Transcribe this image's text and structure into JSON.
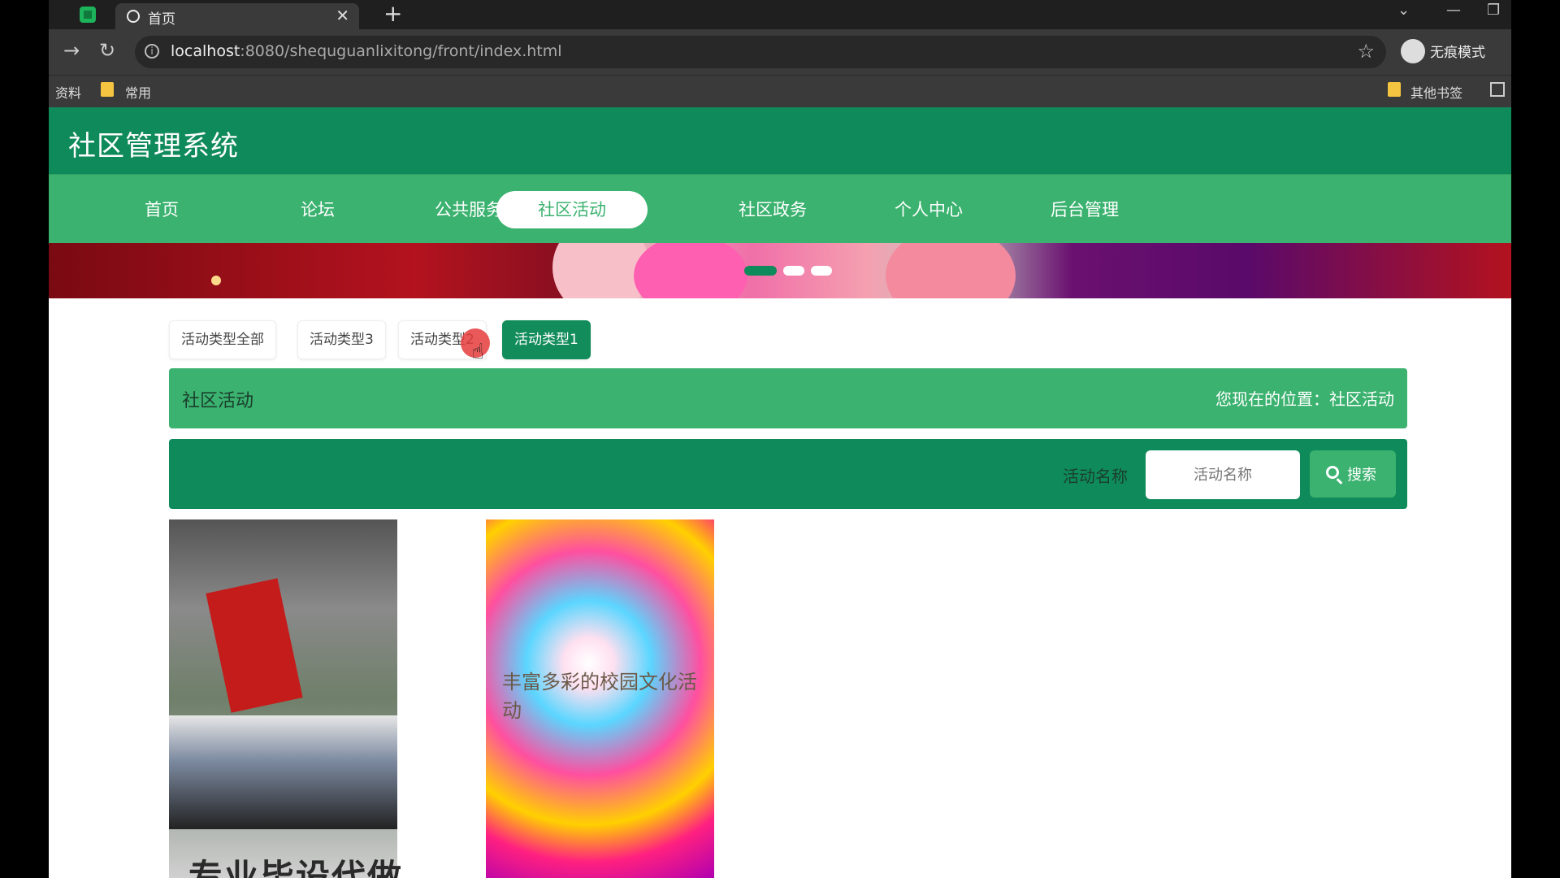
{
  "browser": {
    "tab_title": "首页",
    "tab_close": "✕",
    "new_tab": "+",
    "url_host": "localhost",
    "url_path": ":8080/shequguanlixitong/front/index.html",
    "incognito_label": "无痕模式",
    "bookmarks": [
      "资料",
      "常用"
    ],
    "other_bookmarks": "其他书签",
    "icons": {
      "back": "←",
      "forward": "→",
      "reload": "↻",
      "star": "☆",
      "minimize": "—",
      "restore": "❐",
      "dropdown": "⌄",
      "info": "i"
    }
  },
  "site": {
    "title": "社区管理系统",
    "nav": [
      {
        "label": "首页"
      },
      {
        "label": "论坛"
      },
      {
        "label": "公共服务"
      },
      {
        "label": "社区活动",
        "active": true
      },
      {
        "label": "社区政务"
      },
      {
        "label": "个人中心"
      },
      {
        "label": "后台管理"
      }
    ]
  },
  "filters": [
    {
      "label": "活动类型全部"
    },
    {
      "label": "活动类型3"
    },
    {
      "label": "活动类型2"
    },
    {
      "label": "活动类型1",
      "active": true
    }
  ],
  "section": {
    "title": "社区活动",
    "breadcrumb": "您现在的位置：社区活动"
  },
  "search": {
    "label": "活动名称",
    "placeholder": "活动名称",
    "button": "搜索"
  },
  "cards": [
    {
      "image": "group-photo-with-red-flag"
    },
    {
      "image": "colorful-poster",
      "overlay_text": "丰富多彩的校园文化活动"
    }
  ],
  "bottom_text": "专业毕设代做",
  "colors": {
    "header": "#0f8a5a",
    "nav": "#3bb26f",
    "active_filter": "#128c5b"
  }
}
